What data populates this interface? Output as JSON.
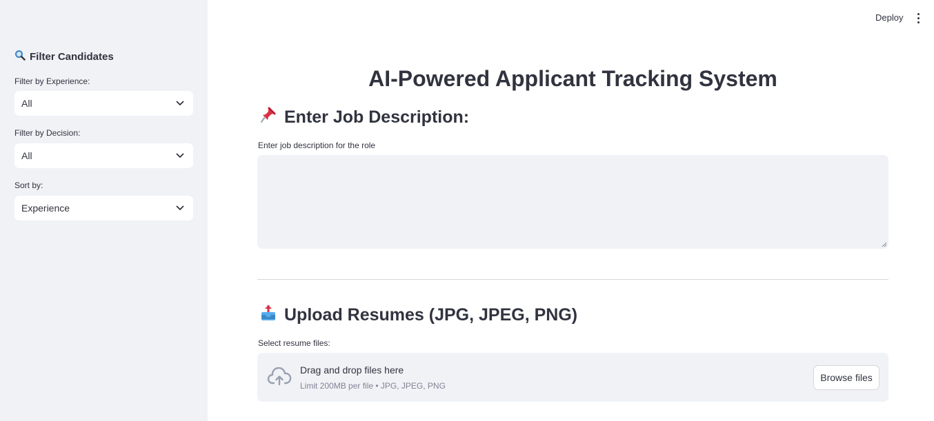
{
  "header": {
    "deploy_label": "Deploy"
  },
  "sidebar": {
    "title": "Filter Candidates",
    "title_icon": "magnifier-icon",
    "filters": [
      {
        "label": "Filter by Experience:",
        "value": "All"
      },
      {
        "label": "Filter by Decision:",
        "value": "All"
      },
      {
        "label": "Sort by:",
        "value": "Experience"
      }
    ]
  },
  "main": {
    "title": "AI-Powered Applicant Tracking System",
    "job_section": {
      "heading": "Enter Job Description:",
      "icon": "pushpin-icon",
      "textarea_label": "Enter job description for the role",
      "textarea_value": ""
    },
    "upload_section": {
      "heading": "Upload Resumes (JPG, JPEG, PNG)",
      "icon": "inbox-tray-icon",
      "label": "Select resume files:",
      "drop_text": "Drag and drop files here",
      "limit_text": "Limit 200MB per file • JPG, JPEG, PNG",
      "browse_label": "Browse files"
    }
  },
  "colors": {
    "sidebar_bg": "#f0f2f6",
    "text": "#31333f",
    "muted": "#808495"
  }
}
